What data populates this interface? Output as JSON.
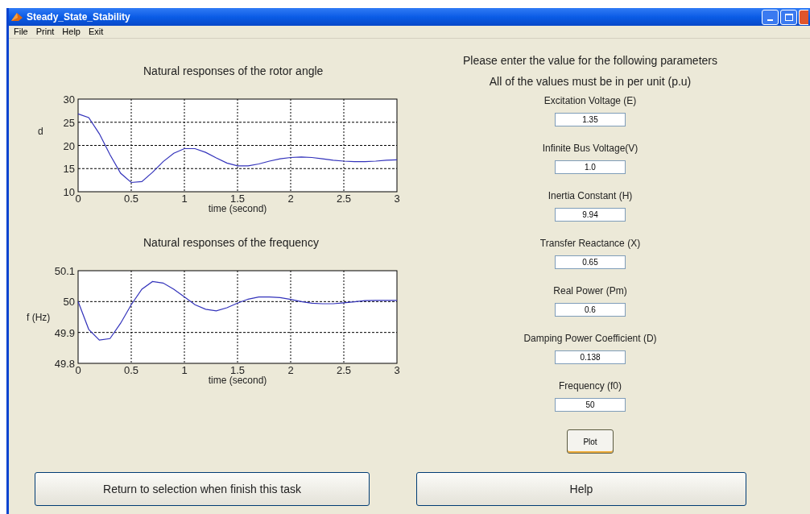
{
  "window": {
    "title": "Steady_State_Stability"
  },
  "menu": [
    "File",
    "Print",
    "Help",
    "Exit"
  ],
  "charts": [
    {
      "title": "Natural responses of the rotor angle",
      "chart_data": {
        "type": "line",
        "xlabel": "time (second)",
        "ylabel": "d",
        "x": [
          0,
          0.1,
          0.2,
          0.3,
          0.4,
          0.5,
          0.6,
          0.7,
          0.8,
          0.9,
          1,
          1.1,
          1.2,
          1.3,
          1.4,
          1.5,
          1.6,
          1.7,
          1.8,
          1.9,
          2,
          2.1,
          2.2,
          2.3,
          2.4,
          2.5,
          2.6,
          2.7,
          2.8,
          2.9,
          3
        ],
        "grid": true,
        "series": [
          {
            "color": "#3333bb",
            "values": [
              26.8,
              26,
              22.5,
              18,
              14,
              12,
              12.2,
              14.2,
              16.5,
              18.3,
              19.3,
              19.3,
              18.5,
              17.3,
              16.2,
              15.6,
              15.6,
              16,
              16.6,
              17.1,
              17.4,
              17.5,
              17.4,
              17.1,
              16.8,
              16.6,
              16.5,
              16.5,
              16.6,
              16.8,
              16.9
            ]
          }
        ],
        "xlim": [
          0,
          3
        ],
        "ylim": [
          10,
          30
        ],
        "xticks": [
          0,
          0.5,
          1,
          1.5,
          2,
          2.5,
          3
        ],
        "yticks": [
          10,
          15,
          20,
          25,
          30
        ]
      }
    },
    {
      "title": "Natural responses of the frequency",
      "chart_data": {
        "type": "line",
        "xlabel": "time (second)",
        "ylabel": "f (Hz)",
        "x": [
          0,
          0.1,
          0.2,
          0.3,
          0.4,
          0.5,
          0.6,
          0.7,
          0.8,
          0.9,
          1,
          1.1,
          1.2,
          1.3,
          1.4,
          1.5,
          1.6,
          1.7,
          1.8,
          1.9,
          2,
          2.1,
          2.2,
          2.3,
          2.4,
          2.5,
          2.6,
          2.7,
          2.8,
          2.9,
          3
        ],
        "grid": true,
        "series": [
          {
            "color": "#3333bb",
            "values": [
              50,
              49.91,
              49.875,
              49.88,
              49.93,
              49.99,
              50.04,
              50.065,
              50.06,
              50.04,
              50.015,
              49.99,
              49.975,
              49.97,
              49.98,
              49.995,
              50.008,
              50.015,
              50.015,
              50.013,
              50.007,
              50,
              49.995,
              49.993,
              49.993,
              49.996,
              49.999,
              50.003,
              50.004,
              50.004,
              50.004
            ]
          }
        ],
        "xlim": [
          0,
          3
        ],
        "ylim": [
          49.8,
          50.1
        ],
        "xticks": [
          0,
          0.5,
          1,
          1.5,
          2,
          2.5,
          3
        ],
        "yticks": [
          49.8,
          49.9,
          50,
          50.1
        ]
      }
    }
  ],
  "instructions": [
    "Please enter the value for the following parameters",
    "All of the values must be in per unit (p.u)"
  ],
  "parameters": [
    {
      "label": "Excitation Voltage (E)",
      "value": "1.35"
    },
    {
      "label": "Infinite Bus Voltage(V)",
      "value": "1.0"
    },
    {
      "label": "Inertia Constant (H)",
      "value": "9.94"
    },
    {
      "label": "Transfer Reactance (X)",
      "value": "0.65"
    },
    {
      "label": "Real Power (Pm)",
      "value": "0.6"
    },
    {
      "label": "Damping Power Coefficient (D)",
      "value": "0.138"
    },
    {
      "label": "Frequency (f0)",
      "value": "50"
    }
  ],
  "plot_button": "Plot",
  "bottom_buttons": [
    "Return to selection when finish this task",
    "Help"
  ]
}
